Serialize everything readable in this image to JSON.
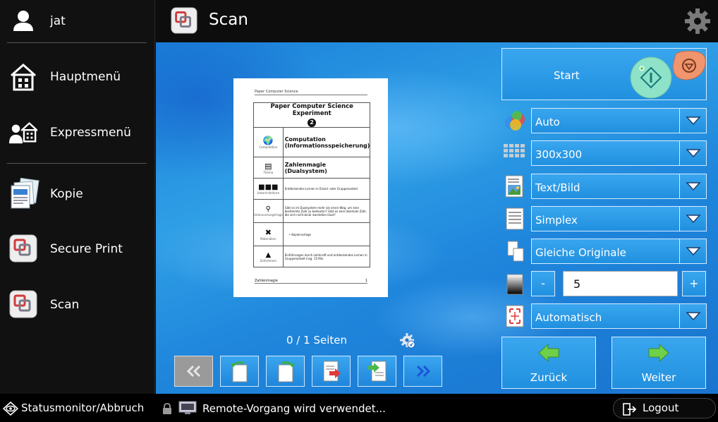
{
  "user": {
    "name": "jat"
  },
  "nav": {
    "items": [
      {
        "label": "Hauptmenü",
        "icon": "home-icon"
      },
      {
        "label": "Expressmenü",
        "icon": "express-menu-icon"
      },
      {
        "label": "Kopie",
        "icon": "copy-icon"
      },
      {
        "label": "Secure Print",
        "icon": "secure-print-icon"
      },
      {
        "label": "Scan",
        "icon": "scan-icon"
      }
    ]
  },
  "header": {
    "title": "Scan",
    "icon": "scan-app-icon",
    "settings_icon": "gear-icon"
  },
  "preview": {
    "header_text": "Paper Computer Science",
    "title": "Paper Computer Science Experiment",
    "title_badge": "2",
    "rows": [
      {
        "icon_caption": "Computation",
        "text": "Computation (Informationsspeicherung)"
      },
      {
        "icon_caption": "Thema",
        "text": "Zahlenmagie (Dualsystem)"
      },
      {
        "icon_caption": "Unterrichtsform",
        "text": "Entdeckendes Lernen in Einzel- oder Gruppenarbeit"
      },
      {
        "icon_caption": "Untersuchungsfrage",
        "text": "Gibt es im Dualsystem mehr als einen Weg, um eine bestimmte Zahl zu bedeuten? Gibt es eine dezimale Zahl, die sich nicht binär darstellen lässt?"
      },
      {
        "icon_caption": "Materialien",
        "text": "• Kopiervorlage"
      },
      {
        "icon_caption": "Zeitrahmen",
        "text": "Einführungen durch Lehrkraft und entdeckendes Lernen in Gruppenarbeit insg. 15 Min."
      }
    ],
    "footer_left": "Zahlenmagie",
    "footer_right": "1",
    "page_count": "0 / 1 Seiten"
  },
  "toolbar": {
    "buttons": [
      {
        "name": "first-page-button",
        "icon": "double-chevron-left-icon",
        "disabled": true
      },
      {
        "name": "rotate-left-button",
        "icon": "rotate-left-icon",
        "disabled": false
      },
      {
        "name": "rotate-right-button",
        "icon": "rotate-right-icon",
        "disabled": false
      },
      {
        "name": "delete-page-button",
        "icon": "delete-page-icon",
        "disabled": false
      },
      {
        "name": "insert-page-button",
        "icon": "insert-page-icon",
        "disabled": false
      },
      {
        "name": "last-page-button",
        "icon": "double-chevron-right-icon",
        "disabled": false
      }
    ]
  },
  "settings": {
    "start_label": "Start",
    "color_mode": "Auto",
    "resolution": "300x300",
    "original_type": "Text/Bild",
    "duplex": "Simplex",
    "originals": "Gleiche Originale",
    "density_value": "5",
    "density_minus": "-",
    "density_plus": "+",
    "size": "Automatisch",
    "back_label": "Zurück",
    "next_label": "Weiter"
  },
  "status": {
    "monitor_label": "Statusmonitor/Abbruch",
    "remote_message": "Remote-Vorgang wird verwendet...",
    "logout_label": "Logout"
  },
  "colors": {
    "accent": "#2090df",
    "start_green": "#8ee2c8",
    "stop_salmon": "#f0956d",
    "arrow_green": "#5fc43c"
  }
}
